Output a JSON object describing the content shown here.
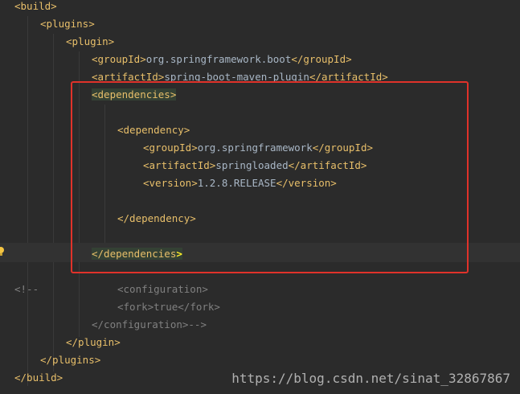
{
  "lines": {
    "l1": "<build>",
    "l2": "<plugins>",
    "l3": "<plugin>",
    "l4_open": "<groupId>",
    "l4_text": "org.springframework.boot",
    "l4_close": "</groupId>",
    "l5_open": "<artifactId>",
    "l5_text": "spring-boot-maven-plugin",
    "l5_close": "</artifactId>",
    "l6": "<dependencies>",
    "l8": "<dependency>",
    "l9_open": "<groupId>",
    "l9_text": "org.springframework",
    "l9_close": "</groupId>",
    "l10_open": "<artifactId>",
    "l10_text": "springloaded",
    "l10_close": "</artifactId>",
    "l11_open": "<version>",
    "l11_text": "1.2.8.RELEASE",
    "l11_close": "</version>",
    "l13": "</dependency>",
    "l15": "</dependencies",
    "l15_bracket": ">",
    "l17_comment": "<!--",
    "l17_tag": "<configuration>",
    "l18_open": "<fork>",
    "l18_text": "true",
    "l18_close": "</fork>",
    "l19": "</configuration>-->",
    "l20": "</plugin>",
    "l21": "</plugins>",
    "l22": "</build>"
  },
  "watermark": "https://blog.csdn.net/sinat_32867867",
  "colors": {
    "background": "#2b2b2b",
    "tag": "#e8bf6a",
    "text": "#a9b7c6",
    "comment": "#808080",
    "highlight": "#344134",
    "annotation_box": "#e0322a"
  }
}
